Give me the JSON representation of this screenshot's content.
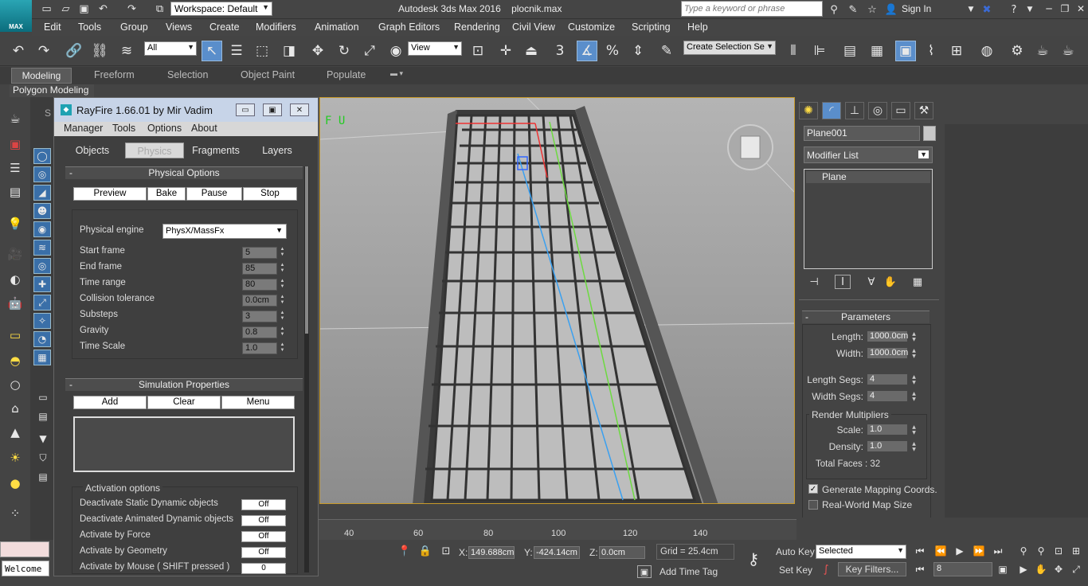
{
  "app": {
    "title": "Autodesk 3ds Max 2016",
    "file": "plocnik.max",
    "logo": "MAX"
  },
  "quick_access": {
    "workspace": "Workspace: Default"
  },
  "search": {
    "placeholder": "Type a keyword or phrase"
  },
  "account": {
    "sign_in": "Sign In"
  },
  "menu": [
    "Edit",
    "Tools",
    "Group",
    "Views",
    "Create",
    "Modifiers",
    "Animation",
    "Graph Editors",
    "Rendering",
    "Civil View",
    "Customize",
    "Scripting",
    "Help"
  ],
  "main_toolbar": {
    "selection_filter": "All",
    "ref_coord": "View",
    "spinner_snap": "3",
    "named_selection": "Create Selection Se"
  },
  "ribbon": {
    "tabs": [
      "Modeling",
      "Freeform",
      "Selection",
      "Object Paint",
      "Populate"
    ],
    "active": "Modeling",
    "panel": "Polygon Modeling"
  },
  "viewport": {
    "label": "F U"
  },
  "rayfire": {
    "title": "RayFire 1.66.01  by Mir Vadim",
    "menu": [
      "Manager",
      "Tools",
      "Options",
      "About"
    ],
    "tabs": [
      "Objects",
      "Physics",
      "Fragments",
      "Layers"
    ],
    "active_tab": "Physics",
    "physical_options": {
      "header": "Physical Options",
      "buttons": [
        "Preview",
        "Bake",
        "Pause",
        "Stop"
      ],
      "engine_label": "Physical engine",
      "engine_value": "PhysX/MassFx",
      "params": [
        {
          "label": "Start frame",
          "value": "5"
        },
        {
          "label": "End frame",
          "value": "85"
        },
        {
          "label": "Time range",
          "value": "80"
        },
        {
          "label": "Collision tolerance",
          "value": "0.0cm"
        },
        {
          "label": "Substeps",
          "value": "3"
        },
        {
          "label": "Gravity",
          "value": "0.8"
        },
        {
          "label": "Time Scale",
          "value": "1.0"
        }
      ]
    },
    "simulation": {
      "header": "Simulation Properties",
      "buttons": [
        "Add",
        "Clear",
        "Menu"
      ]
    },
    "activation": {
      "header": "Activation options",
      "items": [
        {
          "label": "Deactivate Static Dynamic objects",
          "value": "Off"
        },
        {
          "label": "Deactivate Animated Dynamic objects",
          "value": "Off"
        },
        {
          "label": "Activate by Force",
          "value": "Off"
        },
        {
          "label": "Activate by Geometry",
          "value": "Off"
        },
        {
          "label": "Activate by Mouse ( SHIFT pressed )",
          "value": "0"
        }
      ]
    }
  },
  "command_panel": {
    "object_name": "Plane001",
    "modifier_list": "Modifier List",
    "stack": [
      "Plane"
    ],
    "parameters": {
      "header": "Parameters",
      "length_label": "Length:",
      "length": "1000.0cm",
      "width_label": "Width:",
      "width": "1000.0cm",
      "length_segs_label": "Length Segs:",
      "length_segs": "4",
      "width_segs_label": "Width Segs:",
      "width_segs": "4",
      "render_mult": "Render Multipliers",
      "scale_label": "Scale:",
      "scale": "1.0",
      "density_label": "Density:",
      "density": "1.0",
      "total_faces": "Total Faces : 32",
      "gen_mapping": "Generate Mapping Coords.",
      "gen_mapping_checked": true,
      "real_world": "Real-World Map Size",
      "real_world_checked": false
    }
  },
  "timeline": {
    "ticks": [
      "40",
      "60",
      "80",
      "100",
      "120",
      "140"
    ]
  },
  "status": {
    "x_label": "X:",
    "x": "149.688cm",
    "y_label": "Y:",
    "y": "-424.14cm",
    "z_label": "Z:",
    "z": "0.0cm",
    "grid": "Grid = 25.4cm",
    "add_time_tag": "Add Time Tag",
    "auto_key": "Auto Key",
    "set_key": "Set Key",
    "selected": "Selected",
    "key_filters": "Key Filters...",
    "frame": "8",
    "maxscript": "Welcome"
  }
}
